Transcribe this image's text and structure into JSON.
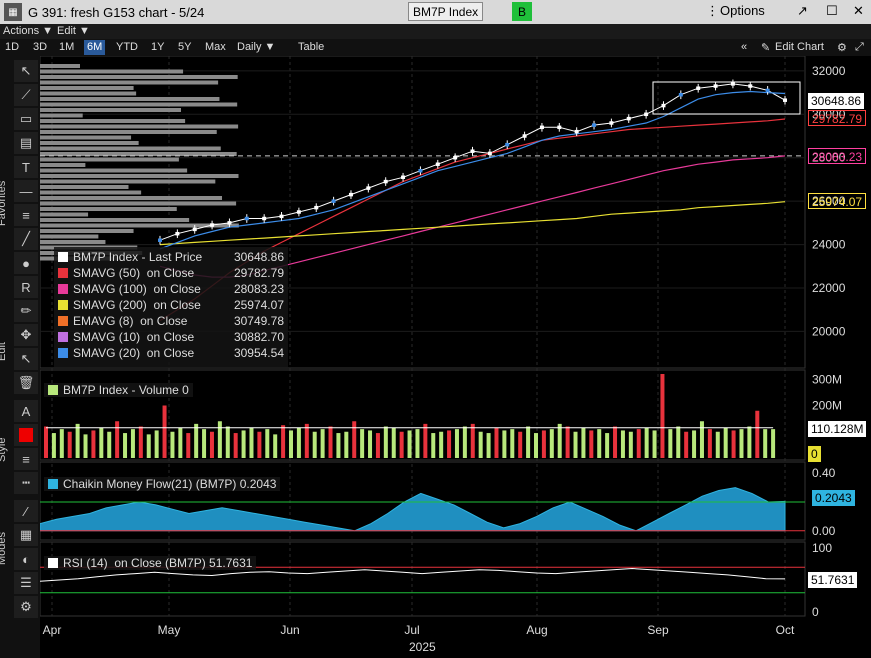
{
  "window": {
    "title": "G 391: fresh G153 chart - 5/24",
    "ticker": "BM7P Index",
    "badge": "B",
    "options_label": "Options"
  },
  "menu": {
    "actions": "Actions ▼",
    "edit": "Edit ▼"
  },
  "ranges": [
    "1D",
    "3D",
    "1M",
    "6M",
    "YTD",
    "1Y",
    "5Y",
    "Max"
  ],
  "active_range": "6M",
  "period": "Daily ▼",
  "table_label": "Table",
  "edit_chart_label": "Edit Chart",
  "sidebar_labels": {
    "favorites": "Favorites",
    "edit": "Edit",
    "style": "Style",
    "modes": "Modes"
  },
  "main_legend": [
    {
      "label": "BM7P Index - Last Price",
      "value": "30648.86",
      "color": "#ffffff"
    },
    {
      "label": "SMAVG (50)  on Close",
      "value": "29782.79",
      "color": "#e8323c"
    },
    {
      "label": "SMAVG (100)  on Close",
      "value": "28083.23",
      "color": "#e83a9a"
    },
    {
      "label": "SMAVG (200)  on Close",
      "value": "25974.07",
      "color": "#e8e032"
    },
    {
      "label": "EMAVG (8)  on Close",
      "value": "30749.78",
      "color": "#f07028"
    },
    {
      "label": "SMAVG (10)  on Close",
      "value": "30882.70",
      "color": "#c070e0"
    },
    {
      "label": "SMAVG (20)  on Close",
      "value": "30954.54",
      "color": "#3c8ce8"
    }
  ],
  "price_labels": [
    {
      "text": "30648.86",
      "bg": "#ffffff",
      "fg": "#000000"
    },
    {
      "text": "29782.79",
      "bg": "#000000",
      "fg": "#ff4040"
    },
    {
      "text": "28083.23",
      "bg": "#000000",
      "fg": "#ff40a0"
    },
    {
      "text": "25974.07",
      "bg": "#000000",
      "fg": "#ffe040"
    }
  ],
  "volume_legend": "BM7P Index - Volume 0",
  "volume_labels": [
    "110.128M",
    "0"
  ],
  "cmf_legend": "Chaikin Money Flow(21) (BM7P) 0.2043",
  "cmf_label": "0.2043",
  "rsi_legend": "RSI (14)  on Close (BM7P) 51.7631",
  "rsi_label": "51.7631",
  "x_year": "2025",
  "chart_data": [
    {
      "type": "line",
      "title": "BM7P Index",
      "x_ticks": [
        "Apr",
        "May",
        "Jun",
        "Jul",
        "Aug",
        "Sep",
        "Oct"
      ],
      "y_ticks": [
        20000,
        22000,
        24000,
        26000,
        28000,
        30000,
        32000
      ],
      "ylim": [
        18500,
        32500
      ],
      "series": [
        {
          "name": "BM7P Index - Last Price",
          "color": "#ffffff",
          "values": [
            24200,
            24500,
            24700,
            24900,
            25000,
            25200,
            25200,
            25300,
            25500,
            25700,
            26000,
            26300,
            26600,
            26900,
            27100,
            27400,
            27700,
            28000,
            28300,
            28200,
            28600,
            29000,
            29400,
            29400,
            29200,
            29500,
            29600,
            29800,
            30000,
            30400,
            30900,
            31200,
            31300,
            31400,
            31300,
            31100,
            30649
          ]
        },
        {
          "name": "SMAVG (50)",
          "color": "#e8323c",
          "values": [
            20500,
            21000,
            21500,
            22100,
            22700,
            23200,
            23700,
            24100,
            24500,
            24900,
            25300,
            25700,
            26100,
            26500,
            26900,
            27200,
            27500,
            27800,
            28000,
            28200,
            28400,
            28600,
            28800,
            28900,
            29000,
            29100,
            29200,
            29300,
            29350,
            29400,
            29450,
            29500,
            29550,
            29600,
            29650,
            29700,
            29783
          ]
        },
        {
          "name": "SMAVG (100)",
          "color": "#e83a9a",
          "values": [
            23000,
            22800,
            22600,
            22500,
            22500,
            22600,
            22800,
            23000,
            23200,
            23400,
            23600,
            23800,
            24000,
            24200,
            24400,
            24600,
            24800,
            25000,
            25200,
            25400,
            25600,
            25800,
            26000,
            26200,
            26400,
            26600,
            26800,
            27000,
            27200,
            27400,
            27550,
            27700,
            27800,
            27900,
            27950,
            28000,
            28083
          ]
        },
        {
          "name": "SMAVG (200)",
          "color": "#e8e032",
          "values": [
            24000,
            24050,
            24100,
            24150,
            24200,
            24250,
            24300,
            24350,
            24400,
            24450,
            24500,
            24550,
            24600,
            24650,
            24700,
            24750,
            24800,
            24850,
            24900,
            24950,
            25000,
            25050,
            25100,
            25150,
            25200,
            25300,
            25400,
            25450,
            25500,
            25550,
            25600,
            25700,
            25750,
            25800,
            25850,
            25900,
            25974
          ]
        },
        {
          "name": "SMAVG (20)",
          "color": "#3c8ce8",
          "values": [
            23800,
            24100,
            24400,
            24600,
            24800,
            24900,
            25000,
            25100,
            25200,
            25400,
            25600,
            25900,
            26200,
            26500,
            26800,
            27100,
            27400,
            27600,
            27800,
            28000,
            28200,
            28500,
            28800,
            29000,
            29100,
            29200,
            29300,
            29450,
            29600,
            29900,
            30300,
            30700,
            30900,
            31000,
            31050,
            31000,
            30955
          ]
        }
      ]
    },
    {
      "type": "bar",
      "title": "BM7P Index - Volume",
      "y_ticks": [
        "100M",
        "200M",
        "300M"
      ],
      "ylim": [
        0,
        320
      ],
      "values": [
        120,
        95,
        110,
        100,
        130,
        90,
        105,
        115,
        100,
        140,
        95,
        110,
        120,
        90,
        105,
        200,
        100,
        115,
        95,
        130,
        110,
        100,
        140,
        120,
        95,
        105,
        115,
        100,
        110,
        90,
        125,
        105,
        115,
        130,
        100,
        110,
        120,
        95,
        100,
        140,
        110,
        105,
        95,
        120,
        115,
        100,
        105,
        110,
        130,
        95,
        100,
        105,
        110,
        120,
        130,
        100,
        95,
        115,
        105,
        110,
        100,
        120,
        95,
        105,
        110,
        130,
        120,
        100,
        115,
        105,
        110,
        95,
        120,
        105,
        100,
        110,
        115,
        105,
        320,
        110,
        120,
        100,
        105,
        140,
        110,
        100,
        115,
        105,
        110,
        120,
        180,
        110,
        110
      ]
    },
    {
      "type": "area",
      "title": "Chaikin Money Flow(21)",
      "y_ticks": [
        "0.00",
        "0.20",
        "0.40"
      ],
      "ylim": [
        -0.05,
        0.45
      ],
      "values": [
        0.05,
        0.08,
        0.1,
        0.12,
        0.16,
        0.18,
        0.2,
        0.18,
        0.15,
        0.12,
        0.14,
        0.16,
        0.14,
        0.12,
        0.1,
        0.08,
        0.06,
        0.04,
        0.02,
        0.0,
        0.05,
        0.12,
        0.2,
        0.26,
        0.22,
        0.18,
        0.12,
        0.06,
        0.02,
        0.05,
        0.1,
        0.16,
        0.2,
        0.15,
        0.1,
        0.04,
        0.0,
        0.06,
        0.12,
        0.18,
        0.24,
        0.28,
        0.3,
        0.26,
        0.2,
        0.2043
      ]
    },
    {
      "type": "line",
      "title": "RSI (14)",
      "y_ticks": [
        0,
        50,
        100
      ],
      "ylim": [
        0,
        100
      ],
      "values": [
        48,
        50,
        52,
        55,
        58,
        60,
        62,
        60,
        58,
        57,
        60,
        62,
        63,
        61,
        60,
        62,
        64,
        66,
        64,
        62,
        60,
        62,
        64,
        66,
        65,
        63,
        61,
        60,
        62,
        64,
        66,
        68,
        66,
        64,
        62,
        60,
        58,
        55,
        52,
        51.76
      ]
    }
  ]
}
